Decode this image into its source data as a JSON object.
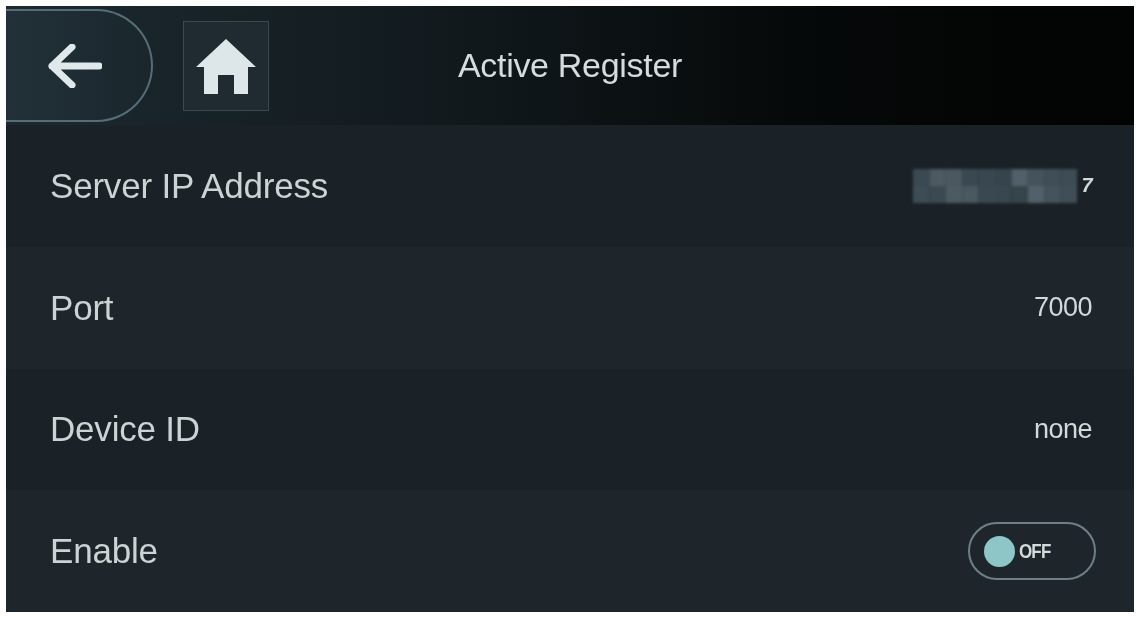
{
  "header": {
    "title": "Active Register"
  },
  "settings": [
    {
      "kind": "value",
      "label": "Server IP Address",
      "masked": true,
      "value": "7"
    },
    {
      "kind": "value",
      "label": "Port",
      "masked": false,
      "value": "7000"
    },
    {
      "kind": "value",
      "label": "Device ID",
      "masked": false,
      "value": "none"
    },
    {
      "kind": "toggle",
      "label": "Enable",
      "on": false,
      "state_label": "OFF"
    }
  ]
}
